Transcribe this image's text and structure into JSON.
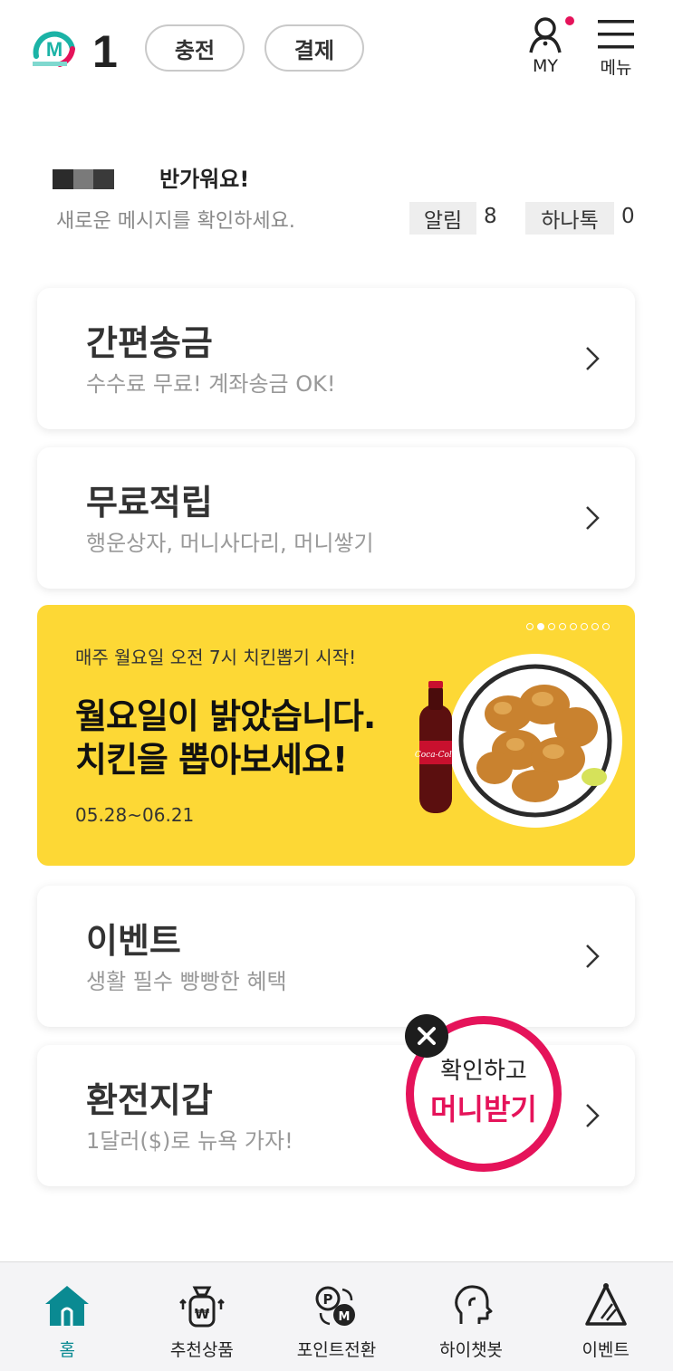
{
  "header": {
    "logo_number": "1",
    "logo_badge": "M",
    "charge_label": "충전",
    "pay_label": "결제",
    "my_label": "MY",
    "menu_label": "메뉴"
  },
  "greeting": {
    "hello": "반가워요!",
    "message": "새로운 메시지를 확인하세요.",
    "alarm_label": "알림",
    "alarm_count": "8",
    "hanatalk_label": "하나톡",
    "hanatalk_count": "0"
  },
  "cards": [
    {
      "title": "간편송금",
      "desc": "수수료 무료! 계좌송금 OK!"
    },
    {
      "title": "무료적립",
      "desc": "행운상자, 머니사다리, 머니쌓기"
    },
    {
      "title": "이벤트",
      "desc": "생활 필수 빵빵한 혜택"
    },
    {
      "title": "환전지갑",
      "desc": "1달러($)로 뉴욕 가자!"
    }
  ],
  "banner": {
    "subtitle": "매주 월요일 오전 7시 치킨뽑기 시작!",
    "line1": "월요일이 밝았습니다.",
    "line2": "치킨을 뽑아보세요!",
    "date": "05.28~06.21",
    "bottle_text": "Coca-Cola",
    "slide_count": 8,
    "active_slide": 2
  },
  "popup": {
    "line1": "확인하고",
    "line2": "머니받기"
  },
  "bottom_nav": [
    {
      "label": "홈",
      "icon": "home-icon"
    },
    {
      "label": "추천상품",
      "icon": "money-bag-icon"
    },
    {
      "label": "포인트전환",
      "icon": "point-exchange-icon"
    },
    {
      "label": "하이챗봇",
      "icon": "chatbot-icon"
    },
    {
      "label": "이벤트",
      "icon": "event-icon"
    }
  ],
  "colors": {
    "brand_teal": "#0a8a92",
    "accent_pink": "#e5135a",
    "banner_yellow": "#fdd835"
  }
}
